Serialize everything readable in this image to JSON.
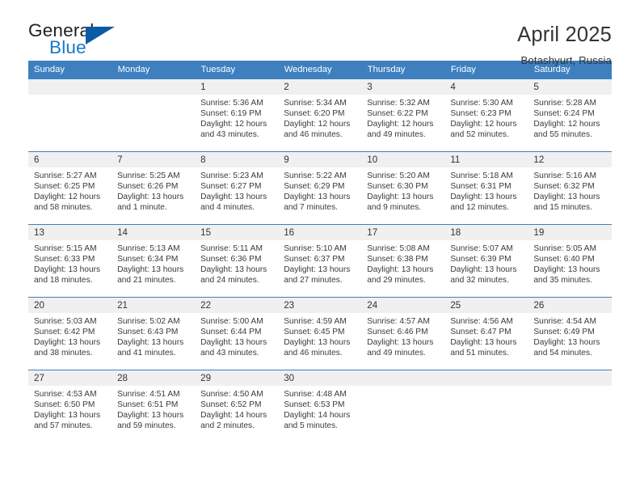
{
  "logo": {
    "word_top": "General",
    "word_bottom": "Blue",
    "triangle_icon": "triangle-icon",
    "colors": {
      "dark": "#231f20",
      "blue": "#1878c4",
      "triangle": "#0a5ba3"
    }
  },
  "header": {
    "title": "April 2025",
    "location": "Botashyurt, Russia"
  },
  "theme": {
    "header_bg": "#3d7fbf",
    "daynum_bg": "#f0f0f0",
    "text": "#333333"
  },
  "calendar": {
    "weekday_headers": [
      "Sunday",
      "Monday",
      "Tuesday",
      "Wednesday",
      "Thursday",
      "Friday",
      "Saturday"
    ],
    "weeks": [
      [
        {
          "day": "",
          "blank": true
        },
        {
          "day": "",
          "blank": true
        },
        {
          "day": "1",
          "sunrise": "Sunrise: 5:36 AM",
          "sunset": "Sunset: 6:19 PM",
          "daylight1": "Daylight: 12 hours",
          "daylight2": "and 43 minutes."
        },
        {
          "day": "2",
          "sunrise": "Sunrise: 5:34 AM",
          "sunset": "Sunset: 6:20 PM",
          "daylight1": "Daylight: 12 hours",
          "daylight2": "and 46 minutes."
        },
        {
          "day": "3",
          "sunrise": "Sunrise: 5:32 AM",
          "sunset": "Sunset: 6:22 PM",
          "daylight1": "Daylight: 12 hours",
          "daylight2": "and 49 minutes."
        },
        {
          "day": "4",
          "sunrise": "Sunrise: 5:30 AM",
          "sunset": "Sunset: 6:23 PM",
          "daylight1": "Daylight: 12 hours",
          "daylight2": "and 52 minutes."
        },
        {
          "day": "5",
          "sunrise": "Sunrise: 5:28 AM",
          "sunset": "Sunset: 6:24 PM",
          "daylight1": "Daylight: 12 hours",
          "daylight2": "and 55 minutes."
        }
      ],
      [
        {
          "day": "6",
          "sunrise": "Sunrise: 5:27 AM",
          "sunset": "Sunset: 6:25 PM",
          "daylight1": "Daylight: 12 hours",
          "daylight2": "and 58 minutes."
        },
        {
          "day": "7",
          "sunrise": "Sunrise: 5:25 AM",
          "sunset": "Sunset: 6:26 PM",
          "daylight1": "Daylight: 13 hours",
          "daylight2": "and 1 minute."
        },
        {
          "day": "8",
          "sunrise": "Sunrise: 5:23 AM",
          "sunset": "Sunset: 6:27 PM",
          "daylight1": "Daylight: 13 hours",
          "daylight2": "and 4 minutes."
        },
        {
          "day": "9",
          "sunrise": "Sunrise: 5:22 AM",
          "sunset": "Sunset: 6:29 PM",
          "daylight1": "Daylight: 13 hours",
          "daylight2": "and 7 minutes."
        },
        {
          "day": "10",
          "sunrise": "Sunrise: 5:20 AM",
          "sunset": "Sunset: 6:30 PM",
          "daylight1": "Daylight: 13 hours",
          "daylight2": "and 9 minutes."
        },
        {
          "day": "11",
          "sunrise": "Sunrise: 5:18 AM",
          "sunset": "Sunset: 6:31 PM",
          "daylight1": "Daylight: 13 hours",
          "daylight2": "and 12 minutes."
        },
        {
          "day": "12",
          "sunrise": "Sunrise: 5:16 AM",
          "sunset": "Sunset: 6:32 PM",
          "daylight1": "Daylight: 13 hours",
          "daylight2": "and 15 minutes."
        }
      ],
      [
        {
          "day": "13",
          "sunrise": "Sunrise: 5:15 AM",
          "sunset": "Sunset: 6:33 PM",
          "daylight1": "Daylight: 13 hours",
          "daylight2": "and 18 minutes."
        },
        {
          "day": "14",
          "sunrise": "Sunrise: 5:13 AM",
          "sunset": "Sunset: 6:34 PM",
          "daylight1": "Daylight: 13 hours",
          "daylight2": "and 21 minutes."
        },
        {
          "day": "15",
          "sunrise": "Sunrise: 5:11 AM",
          "sunset": "Sunset: 6:36 PM",
          "daylight1": "Daylight: 13 hours",
          "daylight2": "and 24 minutes."
        },
        {
          "day": "16",
          "sunrise": "Sunrise: 5:10 AM",
          "sunset": "Sunset: 6:37 PM",
          "daylight1": "Daylight: 13 hours",
          "daylight2": "and 27 minutes."
        },
        {
          "day": "17",
          "sunrise": "Sunrise: 5:08 AM",
          "sunset": "Sunset: 6:38 PM",
          "daylight1": "Daylight: 13 hours",
          "daylight2": "and 29 minutes."
        },
        {
          "day": "18",
          "sunrise": "Sunrise: 5:07 AM",
          "sunset": "Sunset: 6:39 PM",
          "daylight1": "Daylight: 13 hours",
          "daylight2": "and 32 minutes."
        },
        {
          "day": "19",
          "sunrise": "Sunrise: 5:05 AM",
          "sunset": "Sunset: 6:40 PM",
          "daylight1": "Daylight: 13 hours",
          "daylight2": "and 35 minutes."
        }
      ],
      [
        {
          "day": "20",
          "sunrise": "Sunrise: 5:03 AM",
          "sunset": "Sunset: 6:42 PM",
          "daylight1": "Daylight: 13 hours",
          "daylight2": "and 38 minutes."
        },
        {
          "day": "21",
          "sunrise": "Sunrise: 5:02 AM",
          "sunset": "Sunset: 6:43 PM",
          "daylight1": "Daylight: 13 hours",
          "daylight2": "and 41 minutes."
        },
        {
          "day": "22",
          "sunrise": "Sunrise: 5:00 AM",
          "sunset": "Sunset: 6:44 PM",
          "daylight1": "Daylight: 13 hours",
          "daylight2": "and 43 minutes."
        },
        {
          "day": "23",
          "sunrise": "Sunrise: 4:59 AM",
          "sunset": "Sunset: 6:45 PM",
          "daylight1": "Daylight: 13 hours",
          "daylight2": "and 46 minutes."
        },
        {
          "day": "24",
          "sunrise": "Sunrise: 4:57 AM",
          "sunset": "Sunset: 6:46 PM",
          "daylight1": "Daylight: 13 hours",
          "daylight2": "and 49 minutes."
        },
        {
          "day": "25",
          "sunrise": "Sunrise: 4:56 AM",
          "sunset": "Sunset: 6:47 PM",
          "daylight1": "Daylight: 13 hours",
          "daylight2": "and 51 minutes."
        },
        {
          "day": "26",
          "sunrise": "Sunrise: 4:54 AM",
          "sunset": "Sunset: 6:49 PM",
          "daylight1": "Daylight: 13 hours",
          "daylight2": "and 54 minutes."
        }
      ],
      [
        {
          "day": "27",
          "sunrise": "Sunrise: 4:53 AM",
          "sunset": "Sunset: 6:50 PM",
          "daylight1": "Daylight: 13 hours",
          "daylight2": "and 57 minutes."
        },
        {
          "day": "28",
          "sunrise": "Sunrise: 4:51 AM",
          "sunset": "Sunset: 6:51 PM",
          "daylight1": "Daylight: 13 hours",
          "daylight2": "and 59 minutes."
        },
        {
          "day": "29",
          "sunrise": "Sunrise: 4:50 AM",
          "sunset": "Sunset: 6:52 PM",
          "daylight1": "Daylight: 14 hours",
          "daylight2": "and 2 minutes."
        },
        {
          "day": "30",
          "sunrise": "Sunrise: 4:48 AM",
          "sunset": "Sunset: 6:53 PM",
          "daylight1": "Daylight: 14 hours",
          "daylight2": "and 5 minutes."
        },
        {
          "day": "",
          "blank": true
        },
        {
          "day": "",
          "blank": true
        },
        {
          "day": "",
          "blank": true
        }
      ]
    ]
  }
}
